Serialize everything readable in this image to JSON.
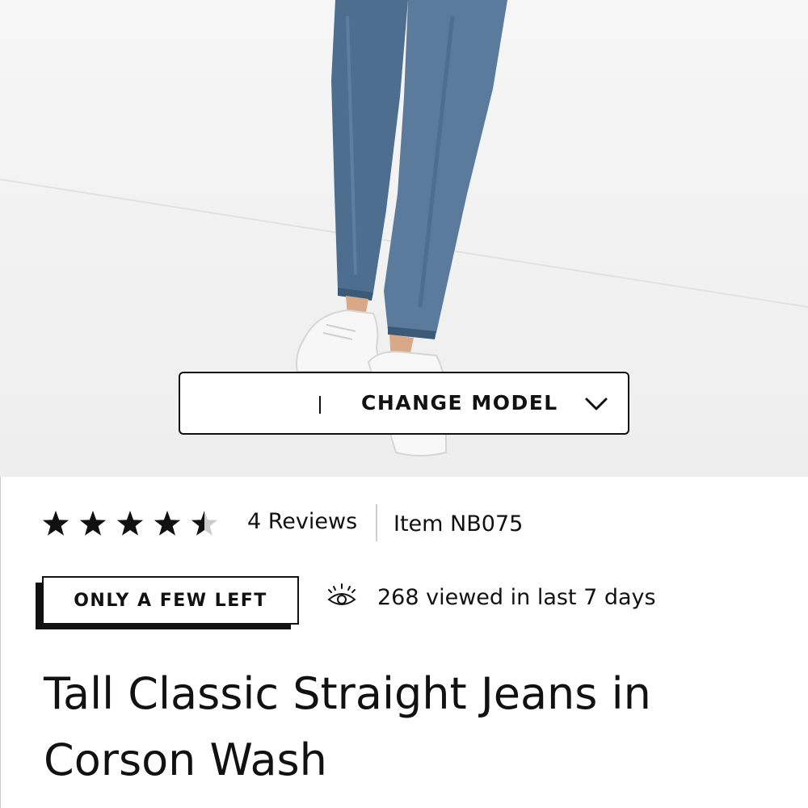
{
  "hero": {
    "change_model_label": "CHANGE MODEL",
    "icon": "chevron-down-icon"
  },
  "rating": {
    "stars": 4.5,
    "max_stars": 5,
    "reviews_label": "4 Reviews",
    "item_label": "Item NB075"
  },
  "badge": {
    "label": "ONLY A FEW LEFT"
  },
  "views": {
    "icon": "eye-icon",
    "label": "268 viewed in last 7 days"
  },
  "product": {
    "title": "Tall Classic Straight Jeans in Corson Wash"
  },
  "colors": {
    "text": "#111111",
    "background": "#ffffff",
    "star_empty": "#cccccc"
  }
}
